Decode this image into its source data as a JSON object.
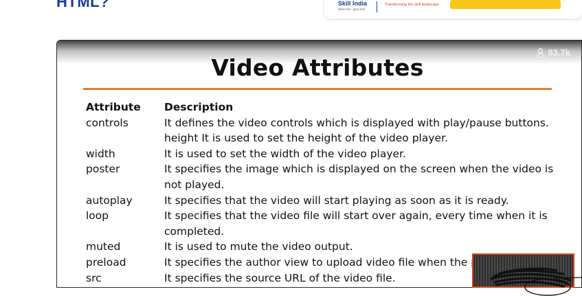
{
  "page": {
    "heading_fragment": "HTML?"
  },
  "ad": {
    "logo_text": "Skill India",
    "logo_subtext": "कौशल भारत - कुशल भारत",
    "tagline": "Transforming the skill landscape"
  },
  "video": {
    "views": "83.7k",
    "slide_title": "Video Attributes",
    "colors": {
      "title_rule": "#ee7a2c",
      "heading_text": "#1b3f8c",
      "ad_cta": "#f7c617"
    },
    "table": {
      "headers": [
        "Attribute",
        "Description"
      ],
      "rows": [
        [
          "controls",
          "It defines the video controls which is displayed with play/pause buttons."
        ],
        [
          "",
          "height  It is used to set the height of the video player."
        ],
        [
          "width",
          "It is used to set the width of the video player."
        ],
        [
          "poster",
          "It specifies the image which is displayed on the screen when the video is"
        ],
        [
          "",
          "not played."
        ],
        [
          "autoplay",
          "It specifies that the video will start playing as soon as it is ready."
        ],
        [
          "loop",
          "It specifies that the video file will start over again, every time when it is"
        ],
        [
          "",
          "completed."
        ],
        [
          "muted",
          "It is used to mute the video output."
        ],
        [
          "preload",
          "It specifies the author view to upload video file when the p"
        ],
        [
          "src",
          "It specifies the source URL of the video file."
        ]
      ]
    }
  }
}
